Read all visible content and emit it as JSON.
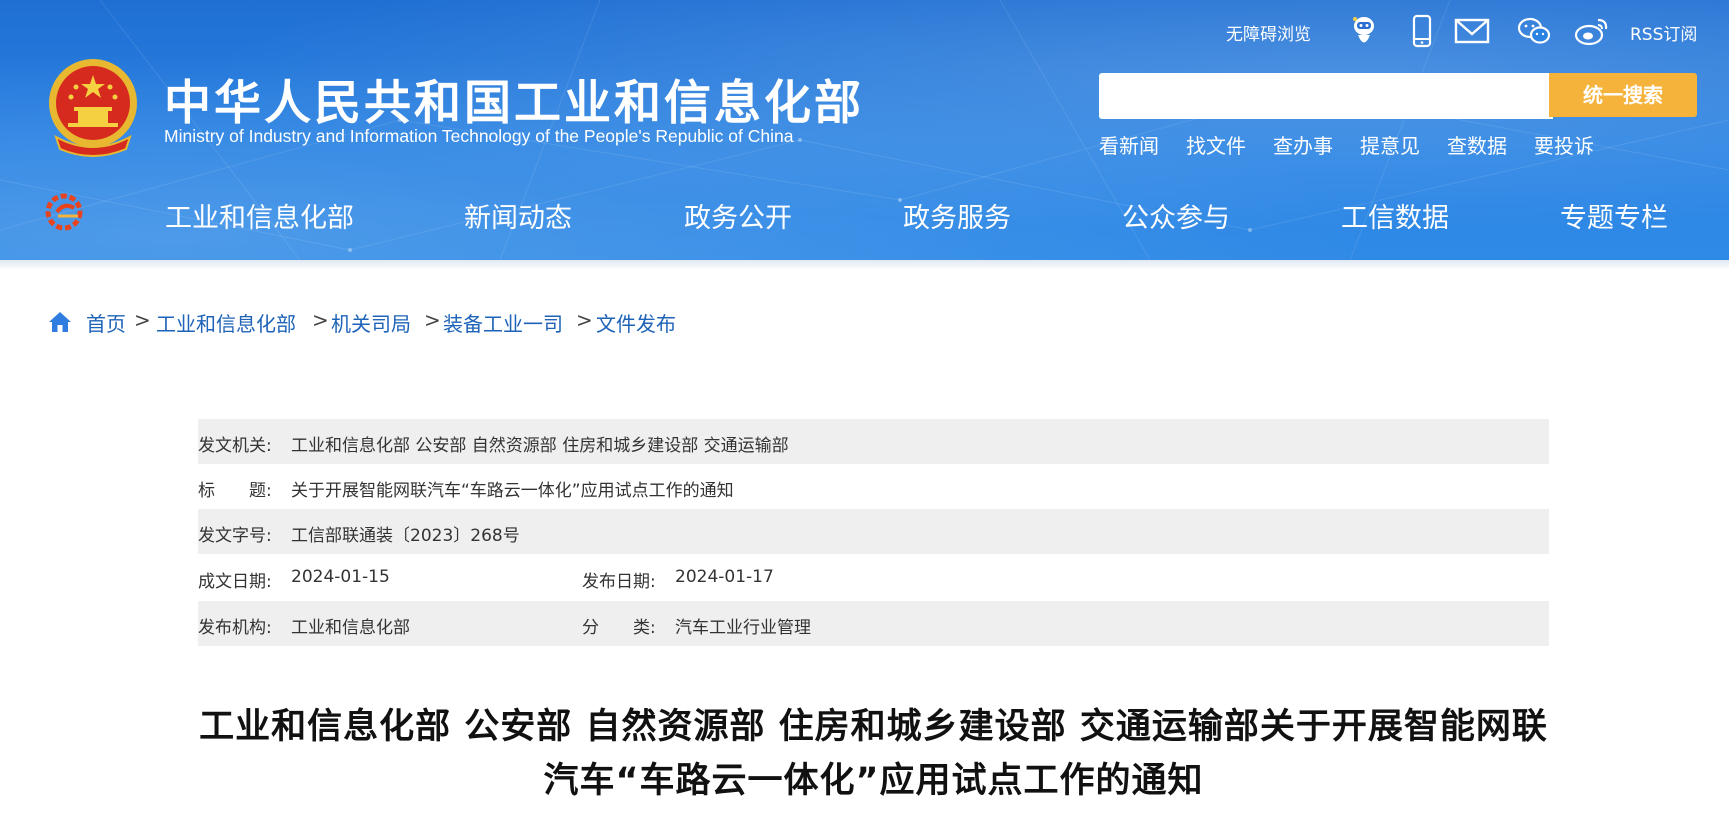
{
  "header": {
    "title_cn": "中华人民共和国工业和信息化部",
    "title_en": "Ministry of Industry and Information Technology of the People's Republic of China",
    "accessibility": "无障碍浏览",
    "rss": "RSS订阅",
    "icons": [
      "robot-icon",
      "mobile-icon",
      "mail-icon",
      "wechat-icon",
      "weibo-icon"
    ]
  },
  "search": {
    "placeholder": "",
    "button": "统一搜索",
    "quick_links": [
      "看新闻",
      "找文件",
      "查办事",
      "提意见",
      "查数据",
      "要投诉"
    ]
  },
  "nav": {
    "items": [
      "工业和信息化部",
      "新闻动态",
      "政务公开",
      "政务服务",
      "公众参与",
      "工信数据",
      "专题专栏"
    ]
  },
  "breadcrumb": [
    "首页",
    "工业和信息化部",
    "机关司局",
    "装备工业一司",
    "文件发布"
  ],
  "doc_meta": {
    "issuer_label": "发文机关:",
    "issuer": "工业和信息化部 公安部 自然资源部 住房和城乡建设部 交通运输部",
    "title_label": "标　　题:",
    "title": "关于开展智能网联汽车“车路云一体化”应用试点工作的通知",
    "docno_label": "发文字号:",
    "docno": "工信部联通装〔2023〕268号",
    "created_label": "成文日期:",
    "created": "2024-01-15",
    "published_label": "发布日期:",
    "published": "2024-01-17",
    "org_label": "发布机构:",
    "org": "工业和信息化部",
    "category_label": "分　　类:",
    "category": "汽车工业行业管理"
  },
  "doc_title_line1": "工业和信息化部 公安部 自然资源部 住房和城乡建设部 交通运输部关于开展智能网联",
  "doc_title_line2": "汽车“车路云一体化”应用试点工作的通知",
  "colors": {
    "header_blue": "#2a83e3",
    "search_button": "#f5b33b",
    "link_blue": "#1e63b8",
    "meta_shade": "#efefef"
  }
}
